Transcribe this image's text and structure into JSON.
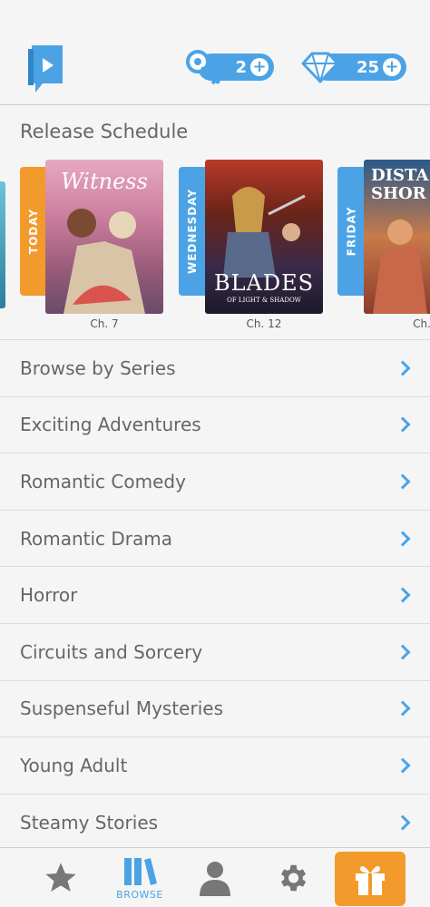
{
  "header": {
    "keys_count": "2",
    "gems_count": "25",
    "plus": "+"
  },
  "release": {
    "title": "Release Schedule",
    "items": [
      {
        "day": "TODAY",
        "cover_title": "Witness",
        "chapter": "Ch. 7",
        "tag_color": "#f39a2c"
      },
      {
        "day": "WEDNESDAY",
        "cover_title": "BLADES",
        "cover_subtitle": "OF LIGHT & SHADOW",
        "chapter": "Ch. 12",
        "tag_color": "#4ba3e6"
      },
      {
        "day": "FRIDAY",
        "cover_title": "DISTA SHOR",
        "chapter": "Ch.",
        "tag_color": "#4ba3e6"
      }
    ]
  },
  "menu": {
    "items": [
      "Browse by Series",
      "Exciting Adventures",
      "Romantic Comedy",
      "Romantic Drama",
      "Horror",
      "Circuits and Sorcery",
      "Suspenseful Mysteries",
      "Young Adult",
      "Steamy Stories"
    ]
  },
  "tabbar": {
    "browse_label": "BROWSE"
  },
  "colors": {
    "accent": "#4ba3e6",
    "orange": "#f39a2c",
    "background": "#f5f5f5"
  }
}
